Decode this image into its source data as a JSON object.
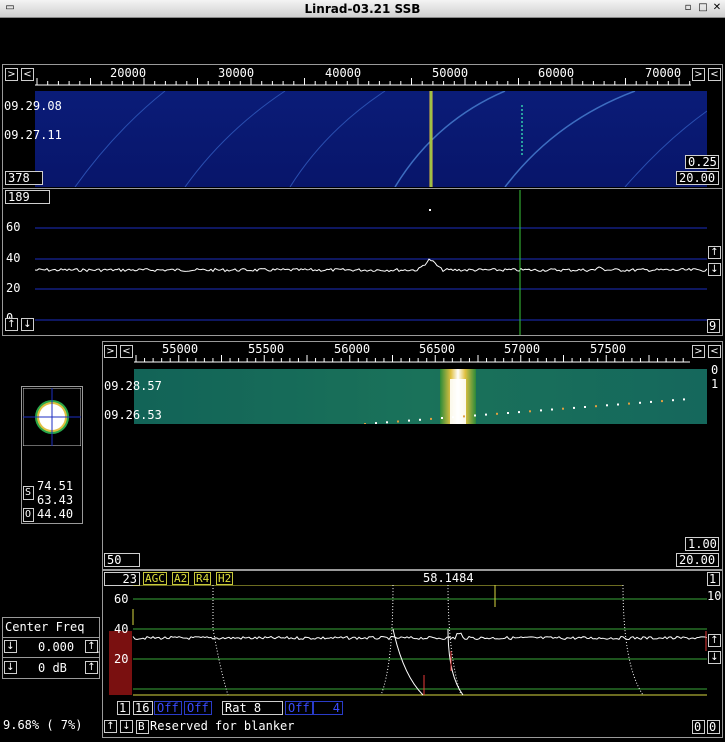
{
  "window": {
    "title": "Linrad-03.21 SSB"
  },
  "wide": {
    "freq_ticks": [
      "20000",
      "30000",
      "40000",
      "50000",
      "60000",
      "70000"
    ],
    "times": [
      "09.29.08",
      "09.27.11"
    ],
    "box_left": "378",
    "box_r1": "0.25",
    "box_r2": "20.00",
    "spec_top_box": "189",
    "ylabels": [
      "60",
      "40",
      "20",
      "0"
    ],
    "right_box": "9"
  },
  "hires": {
    "freq_ticks": [
      "55000",
      "55500",
      "56000",
      "56500",
      "57000",
      "57500"
    ],
    "times": [
      "09.28.57",
      "09.26.53"
    ],
    "side_nums": [
      "0",
      "1"
    ],
    "box_left": "50",
    "box_r1": "1.00",
    "box_r2": "20.00"
  },
  "smeter": {
    "s_label": "S",
    "o_label": "O",
    "v1": "74.51",
    "v2": "63.43",
    "v3": "44.40"
  },
  "baseband": {
    "box_left": "23",
    "tags": [
      "AGC",
      "A2",
      "R4",
      "H2"
    ],
    "freq": "58.1484",
    "right_box": "1",
    "ylabels": [
      "60",
      "40",
      "20"
    ],
    "right_num": "10",
    "box_bl": "1",
    "box_16": "16",
    "off1": "Off",
    "off2": "Off",
    "rat": "Rat  8",
    "off3": "Off",
    "four": "4",
    "blanker_b": "B",
    "blanker_text": "Reserved for blanker",
    "zero1": "0",
    "zero2": "0"
  },
  "center_freq": {
    "title": "Center Freq",
    "value": "0.000",
    "db": "0 dB"
  },
  "status": {
    "cpu": "9.68%  ( 7%)"
  }
}
